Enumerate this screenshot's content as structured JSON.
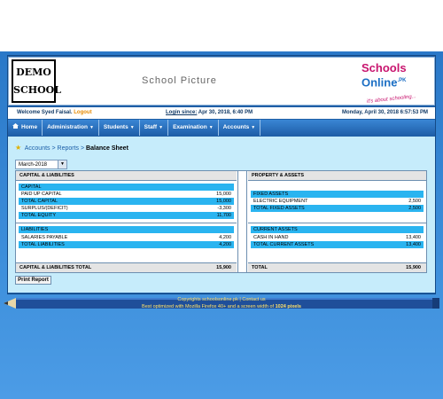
{
  "banner": {
    "logo_line1": "DEMO",
    "logo_line2": "SCHOOL",
    "school_picture": "School Picture",
    "brand": {
      "part1": "Schools",
      "part2": "Online",
      "suffix": ".PK",
      "tagline": "it's about schooling..."
    }
  },
  "welcome": {
    "greeting": "Welcome Syed Faisal.",
    "logout": "Logout",
    "login_label": "Login since:",
    "login_value": "Apr 30, 2018, 6:40 PM",
    "datetime": "Monday, April 30, 2018 6:57:53 PM"
  },
  "nav": {
    "home": "Home",
    "administration": "Administration",
    "students": "Students",
    "staff": "Staff",
    "examination": "Examination",
    "accounts": "Accounts"
  },
  "breadcrumb": {
    "accounts": "Accounts",
    "reports": "Reports",
    "current": "Balance Sheet",
    "sep": ">"
  },
  "period_select": {
    "value": "March-2018"
  },
  "balance_sheet": {
    "left_header": "CAPITAL & LIABILITIES",
    "right_header": "PROPERTY & ASSETS",
    "capital": {
      "title": "CAPITAL",
      "paid_up_label": "PAID UP CAPITAL",
      "paid_up": "15,000",
      "total_capital_label": "TOTAL CAPITAL",
      "total_capital": "15,000",
      "surplus_label": "SURPLUS/(DEFICIT)",
      "surplus": "-3,300",
      "total_equity_label": "TOTAL EQUITY",
      "total_equity": "11,700"
    },
    "liabilities": {
      "title": "LIABILITIES",
      "salaries_label": "SALARIES PAYABLE",
      "salaries": "4,200",
      "total_label": "TOTAL LIABILITIES",
      "total": "4,200"
    },
    "left_total_label": "CAPITAL & LIABILITIES TOTAL",
    "left_total": "15,900",
    "fixed_assets": {
      "title": "FIXED ASSETS",
      "equipment_label": "ELECTRIC EQUIPMENT",
      "equipment": "2,500",
      "total_label": "TOTAL FIXED ASSETS",
      "total": "2,500"
    },
    "current_assets": {
      "title": "CURRENT ASSETS",
      "cash_label": "CASH IN HAND",
      "cash": "13,400",
      "total_label": "TOTAL CURRENT ASSETS",
      "total": "13,400"
    },
    "right_total_label": "TOTAL",
    "right_total": "15,900"
  },
  "print_button": "Print Report",
  "footer": {
    "copyright": "Copyrights schoolsonline.pk",
    "contact": "Contact us",
    "optimized_prefix": "Best optimized with Mozilla Firefox 40+ and a screen width of",
    "optimized_width": "1024 pixels"
  }
}
